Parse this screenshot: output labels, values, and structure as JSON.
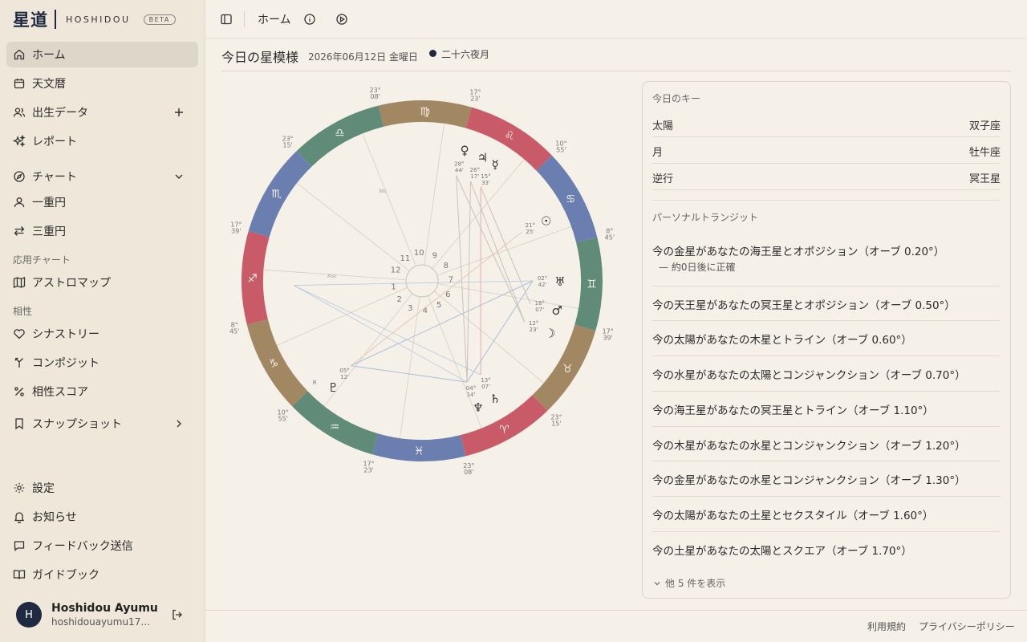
{
  "brand": {
    "kanji": "星道",
    "name": "HOSHIDOU",
    "badge": "BETA"
  },
  "nav": {
    "home": "ホーム",
    "calendar": "天文暦",
    "birth_data": "出生データ",
    "reports": "レポート",
    "chart": "チャート",
    "single": "一重円",
    "triple": "三重円",
    "section_applied": "応用チャート",
    "astromap": "アストロマップ",
    "section_compat": "相性",
    "synastry": "シナストリー",
    "composite": "コンポジット",
    "compat_score": "相性スコア",
    "snapshot": "スナップショット",
    "settings": "設定",
    "notifications": "お知らせ",
    "feedback": "フィードバック送信",
    "guidebook": "ガイドブック"
  },
  "user": {
    "initial": "H",
    "name": "Hoshidou Ayumu",
    "email": "hoshidouayumu1781..."
  },
  "topbar": {
    "title": "ホーム"
  },
  "header": {
    "title": "今日の星模様",
    "date": "2026年06月12日 金曜日",
    "moon_phase": "二十六夜月"
  },
  "wheel": {
    "colors": {
      "fire": "#c95a68",
      "earth": "#a28763",
      "air": "#5f8b78",
      "water": "#6a7fb0"
    },
    "mc_label": "Mc",
    "asc_label": "Asc",
    "retro_label": "R",
    "sign_glyphs": [
      "♍",
      "♌",
      "♋",
      "♊",
      "♉",
      "♈",
      "♓",
      "♒",
      "♑",
      "♐",
      "♏",
      "♎"
    ],
    "degree_labels": [
      [
        "23°",
        "08'"
      ],
      [
        "17°",
        "23'"
      ],
      [
        "10°",
        "55'"
      ],
      [
        "8°",
        "45'"
      ],
      [
        "17°",
        "39'"
      ],
      [
        "23°",
        "15'"
      ],
      [
        "23°",
        "08'"
      ],
      [
        "17°",
        "23'"
      ],
      [
        "10°",
        "55'"
      ],
      [
        "8°",
        "45'"
      ],
      [
        "17°",
        "39'"
      ],
      [
        "23°",
        "15'"
      ]
    ],
    "planets": [
      {
        "glyph": "♀",
        "deg": "28°",
        "min": "44'"
      },
      {
        "glyph": "♃",
        "deg": "26°",
        "min": "17'"
      },
      {
        "glyph": "☿",
        "deg": "15°",
        "min": "33'"
      },
      {
        "glyph": "☉",
        "deg": "21°",
        "min": "25'"
      },
      {
        "glyph": "♅",
        "deg": "02°",
        "min": "42'"
      },
      {
        "glyph": "♂",
        "deg": "18°",
        "min": "07'"
      },
      {
        "glyph": "☽",
        "deg": "12°",
        "min": "23'"
      },
      {
        "glyph": "♄",
        "deg": "13°",
        "min": "07'"
      },
      {
        "glyph": "♆",
        "deg": "04°",
        "min": "14'"
      },
      {
        "glyph": "♇",
        "deg": "05°",
        "min": "12'"
      }
    ],
    "houses": [
      "1",
      "2",
      "3",
      "4",
      "5",
      "6",
      "7",
      "8",
      "9",
      "10",
      "11",
      "12"
    ]
  },
  "key_panel": {
    "title": "今日のキー",
    "rows": [
      {
        "key": "太陽",
        "value": "双子座"
      },
      {
        "key": "月",
        "value": "牡牛座"
      },
      {
        "key": "逆行",
        "value": "冥王星"
      }
    ]
  },
  "transits": {
    "title": "パーソナルトランジット",
    "items": [
      {
        "text": "今の金星があなたの海王星とオポジション（オーブ 0.20°）",
        "sub": "— 約0日後に正確"
      },
      {
        "text": "今の天王星があなたの冥王星とオポジション（オーブ 0.50°）"
      },
      {
        "text": "今の太陽があなたの木星とトライン（オーブ 0.60°）"
      },
      {
        "text": "今の水星があなたの太陽とコンジャンクション（オーブ 0.70°）"
      },
      {
        "text": "今の海王星があなたの冥王星とトライン（オーブ 1.10°）"
      },
      {
        "text": "今の木星があなたの水星とコンジャンクション（オーブ 1.20°）"
      },
      {
        "text": "今の金星があなたの水星とコンジャンクション（オーブ 1.30°）"
      },
      {
        "text": "今の太陽があなたの土星とセクスタイル（オーブ 1.60°）"
      },
      {
        "text": "今の土星があなたの太陽とスクエア（オーブ 1.70°）"
      }
    ],
    "show_more": "他 5 件を表示"
  },
  "footer": {
    "terms": "利用規約",
    "privacy": "プライバシーポリシー"
  }
}
